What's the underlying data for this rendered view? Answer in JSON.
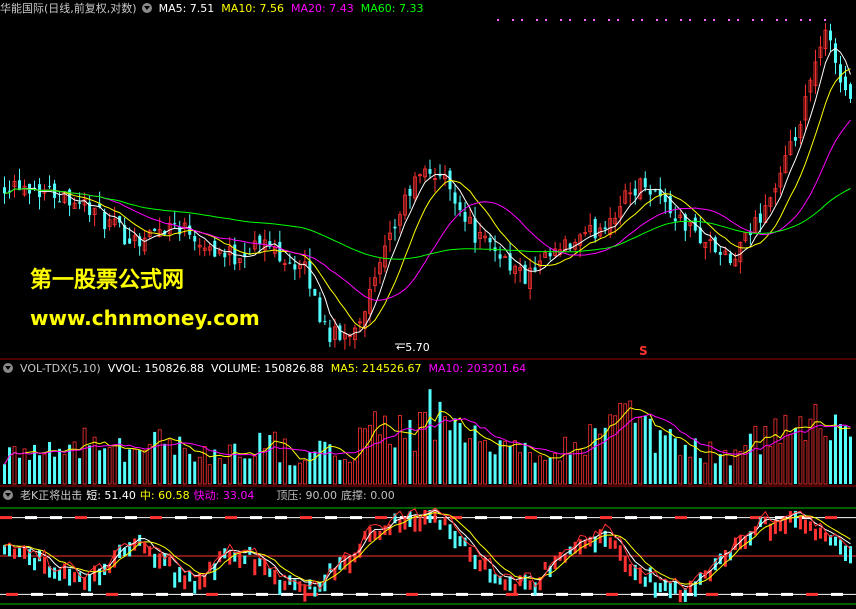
{
  "colors": {
    "background": "#000000",
    "up": "#ff3232",
    "down": "#54ffff",
    "ma5": "#ffffff",
    "ma10": "#ffff00",
    "ma20": "#ff00ff",
    "ma60": "#00ff00",
    "separator": "#a00000",
    "watermark": "#ffff00"
  },
  "price_panel": {
    "title": "华能国际(日线,前复权,对数)",
    "ma5": "MA5: 7.51",
    "ma10": "MA10: 7.56",
    "ma20": "MA20: 7.43",
    "ma60": "MA60: 7.33",
    "low_marker": "5.70",
    "flag": "S"
  },
  "volume_panel": {
    "title": "VOL-TDX(5,10)",
    "vvol": "VVOL: 150826.88",
    "volume": "VOLUME: 150826.88",
    "ma5": "MA5: 214526.67",
    "ma10": "MA10: 203201.64"
  },
  "indicator_panel": {
    "title": "老K正将出击",
    "short": "短: 51.40",
    "mid": "中: 60.58",
    "fast": "快动: 33.04",
    "top": "顶压: 90.00",
    "bottom": "底撑: 0.00"
  },
  "watermark": {
    "line1": "第一股票公式网",
    "line2": "www.chnmoney.com"
  },
  "chart_data": {
    "type": "candlestick",
    "title": "华能国际(日线,前复权,对数)",
    "low_point": 5.7,
    "ma_latest": {
      "MA5": 7.51,
      "MA10": 7.56,
      "MA20": 7.43,
      "MA60": 7.33
    },
    "volume_latest": {
      "VVOL": 150826.88,
      "VOLUME": 150826.88,
      "MA5": 214526.67,
      "MA10": 203201.64
    },
    "indicator_latest": {
      "short": 51.4,
      "mid": 60.58,
      "fast": 33.04,
      "top": 90.0,
      "bottom": 0.0
    },
    "close_path": [
      7.28,
      7.3,
      7.26,
      7.22,
      7.19,
      7.16,
      7.1,
      7.02,
      6.9,
      6.8,
      6.72,
      6.68,
      6.72,
      6.8,
      6.85,
      6.8,
      6.7,
      6.6,
      6.54,
      6.5,
      6.56,
      6.64,
      6.6,
      6.52,
      6.42,
      6.34,
      5.95,
      5.75,
      5.72,
      5.85,
      6.05,
      6.35,
      6.7,
      7.05,
      7.3,
      7.42,
      7.38,
      7.22,
      6.95,
      6.72,
      6.6,
      6.55,
      6.4,
      6.28,
      6.35,
      6.48,
      6.55,
      6.62,
      6.68,
      6.78,
      6.9,
      7.05,
      7.22,
      7.3,
      7.18,
      7.0,
      6.86,
      6.76,
      6.66,
      6.55,
      6.42,
      6.58,
      6.82,
      7.05,
      7.3,
      7.65,
      8.05,
      8.7,
      9.2,
      8.7,
      8.25
    ],
    "volume_path": [
      0.3,
      0.28,
      0.32,
      0.35,
      0.3,
      0.26,
      0.38,
      0.42,
      0.36,
      0.4,
      0.34,
      0.3,
      0.36,
      0.4,
      0.38,
      0.33,
      0.28,
      0.26,
      0.3,
      0.28,
      0.34,
      0.42,
      0.38,
      0.32,
      0.28,
      0.26,
      0.3,
      0.28,
      0.27,
      0.34,
      0.48,
      0.62,
      0.55,
      0.45,
      0.5,
      0.72,
      0.6,
      0.44,
      0.5,
      0.4,
      0.34,
      0.36,
      0.3,
      0.28,
      0.33,
      0.38,
      0.35,
      0.34,
      0.4,
      0.45,
      0.48,
      0.66,
      0.54,
      0.48,
      0.4,
      0.38,
      0.34,
      0.32,
      0.3,
      0.28,
      0.26,
      0.32,
      0.4,
      0.44,
      0.46,
      0.5,
      0.56,
      0.8,
      0.7,
      0.55,
      0.42
    ],
    "indicator_path": [
      62,
      60,
      55,
      48,
      40,
      36,
      30,
      38,
      50,
      62,
      66,
      58,
      44,
      32,
      28,
      40,
      52,
      60,
      54,
      42,
      30,
      24,
      20,
      26,
      38,
      50,
      64,
      78,
      88,
      92,
      95,
      96,
      90,
      76,
      60,
      48,
      36,
      28,
      24,
      30,
      42,
      56,
      68,
      74,
      70,
      58,
      44,
      34,
      26,
      20,
      18,
      26,
      40,
      56,
      70,
      82,
      88,
      92,
      90,
      84,
      78,
      70,
      62
    ]
  }
}
